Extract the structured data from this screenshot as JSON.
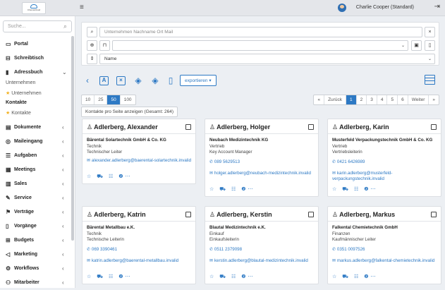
{
  "header": {
    "logo_text": "ChemieCloud",
    "user_name": "Charlie Cooper (Standard)"
  },
  "sidebar": {
    "search_placeholder": "Suche...",
    "items": [
      {
        "label": "Portal",
        "icon": "desktop-icon",
        "glyph": "▭"
      },
      {
        "label": "Schreibtisch",
        "icon": "inbox-icon",
        "glyph": "⊟"
      },
      {
        "label": "Adressbuch",
        "icon": "book-icon",
        "glyph": "▮",
        "expanded": true
      },
      {
        "label": "Dokumente",
        "icon": "document-icon",
        "glyph": "▤"
      },
      {
        "label": "Maileingang",
        "icon": "mail-icon",
        "glyph": "◎"
      },
      {
        "label": "Aufgaben",
        "icon": "tasks-icon",
        "glyph": "☰"
      },
      {
        "label": "Meetings",
        "icon": "meetings-icon",
        "glyph": "▦"
      },
      {
        "label": "Sales",
        "icon": "sales-icon",
        "glyph": "▥"
      },
      {
        "label": "Service",
        "icon": "wrench-icon",
        "glyph": "✎"
      },
      {
        "label": "Verträge",
        "icon": "contract-icon",
        "glyph": "⚑"
      },
      {
        "label": "Vorgänge",
        "icon": "clipboard-icon",
        "glyph": "▯"
      },
      {
        "label": "Budgets",
        "icon": "budget-icon",
        "glyph": "⊞"
      },
      {
        "label": "Marketing",
        "icon": "megaphone-icon",
        "glyph": "◁"
      },
      {
        "label": "Workflows",
        "icon": "workflow-icon",
        "glyph": "⚙"
      },
      {
        "label": "Mitarbeiter",
        "icon": "users-icon",
        "glyph": "⚇"
      }
    ],
    "adressbuch_sub": {
      "group1": "Unternehmen",
      "fav1": "Unternehmen",
      "group2": "Kontakte",
      "fav2": "Kontakte"
    }
  },
  "filter": {
    "search_placeholder": "Unternehmen Nachname Ort Mail",
    "clear_label": "×",
    "sort_value": "Name"
  },
  "toolbar": {
    "export_label": "exportieren ▾"
  },
  "pagination": {
    "sizes": [
      "10",
      "25",
      "50",
      "100"
    ],
    "pages": [
      "«",
      "Zurück",
      "1",
      "2",
      "3",
      "4",
      "5",
      "6",
      "Weiter",
      "»"
    ],
    "info": "Kontakte pro Seite anzeigen (Gesamt: 264)"
  },
  "contacts": [
    {
      "name": "Adlerberg, Alexander",
      "company": "Bärental Solartechnik GmbH & Co. KG",
      "department": "Technik",
      "position": "Technischer Leiter",
      "phone": "",
      "email": "alexander.adlerberg@baerental-solartechnik.invalid"
    },
    {
      "name": "Adlerberg, Holger",
      "company": "Neubach Medizintechnik KG",
      "department": "Vertrieb",
      "position": "Key Account Manager",
      "phone": "089 5629513",
      "email": "holger.adlerberg@neubach-medizintechnik.invalid"
    },
    {
      "name": "Adlerberg, Karin",
      "company": "Musterfeld Verpackungstechnik GmbH & Co. KG",
      "department": "Vertrieb",
      "position": "Vertriebsleiterin",
      "phone": "0421 6426989",
      "email": "karin.adlerberg@musterfeld-verpackungstechnik.invalid"
    },
    {
      "name": "Adlerberg, Katrin",
      "company": "Bärental Metallbau e.K.",
      "department": "Technik",
      "position": "Technische Leiterin",
      "phone": "069 3390461",
      "email": "katrin.adlerberg@baerental-metallbau.invalid"
    },
    {
      "name": "Adlerberg, Kerstin",
      "company": "Blautal Medizintechnik e.K.",
      "department": "Einkauf",
      "position": "Einkaufsleiterin",
      "phone": "0511 2379098",
      "email": "kerstin.adlerberg@blautal-medizintechnik.invalid"
    },
    {
      "name": "Adlerberg, Markus",
      "company": "Falkental Chemietechnik GmbH",
      "department": "Finanzen",
      "position": "Kaufmännischer Leiter",
      "phone": "0351 0097526",
      "email": "markus.adlerberg@falkental-chemietechnik.invalid"
    }
  ],
  "card_actions": "☆ ⛟ ☷ ❷⋯",
  "colors": {
    "accent": "#2d79c4",
    "favorite": "#f2b01e"
  }
}
